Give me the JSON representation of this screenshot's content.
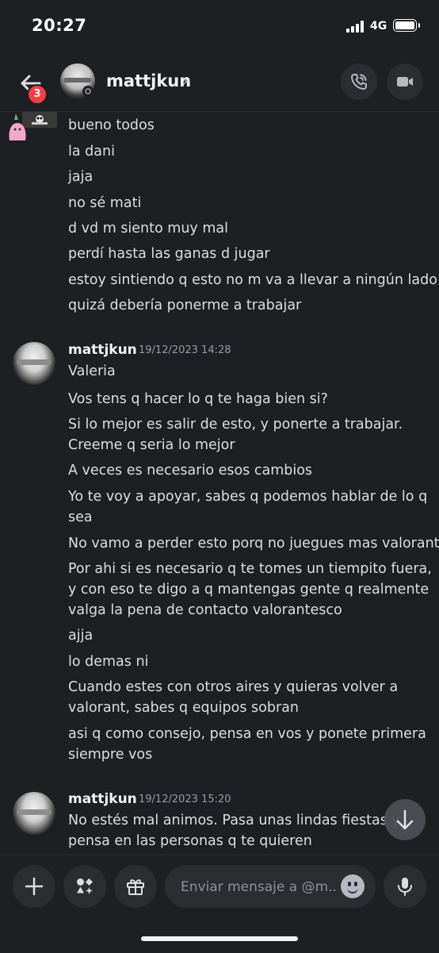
{
  "status_bar": {
    "time": "20:27",
    "network": "4G"
  },
  "header": {
    "username": "mattjkun",
    "chevron": "›",
    "badge_count": "3"
  },
  "messages": {
    "group1": [
      "bueno todos",
      "la dani",
      "jaja",
      "no sé mati",
      "d vd m siento muy mal",
      "perdí hasta las ganas d jugar",
      "estoy sintiendo q esto no m va a llevar a ningún lado",
      "quizá debería ponerme a trabajar"
    ],
    "group2": {
      "author": "mattjkun",
      "timestamp": "19/12/2023 14:28",
      "lines": [
        "Valeria",
        "Vos tens q hacer lo q te haga bien si?",
        "Si lo mejor es salir de esto, y ponerte a trabajar.",
        "Creeme q seria lo mejor",
        "A veces es necesario esos cambios",
        "Yo te voy a apoyar, sabes q podemos hablar de lo q",
        "sea",
        "No vamo a perder esto porq no juegues mas valorant",
        "Por ahi si es necesario q te tomes un tiempito fuera,",
        "y con eso te digo a q mantengas gente q realmente",
        "valga la pena de contacto valorantesco",
        "ajja",
        "lo demas ni",
        "Cuando estes con otros aires y quieras volver a",
        "valorant, sabes q equipos sobran",
        "asi q como consejo, pensa en vos y ponete primera",
        "siempre vos"
      ]
    },
    "group3": {
      "author": "mattjkun",
      "timestamp": "19/12/2023 15:20",
      "lines": [
        "No estés mal animos. Pasa unas lindas fiestas y",
        "pensa en las personas q te quieren"
      ]
    }
  },
  "composer": {
    "placeholder": "Enviar mensaje a @m..."
  },
  "icons": [
    "back-arrow-icon",
    "phone-call-icon",
    "video-camera-icon",
    "plus-icon",
    "apps-icon",
    "gift-icon",
    "emoji-icon",
    "microphone-icon",
    "arrow-down-icon"
  ]
}
